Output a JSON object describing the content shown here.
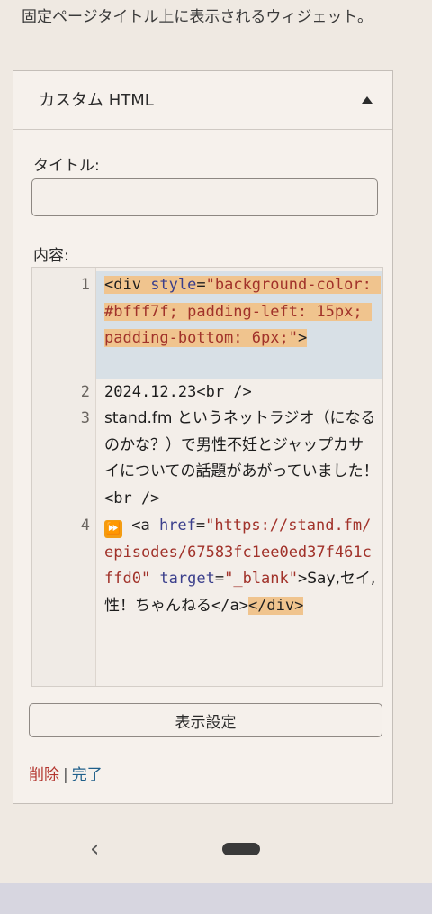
{
  "intro_text": "固定ページタイトル上に表示されるウィジェット。",
  "widget": {
    "title": "カスタム HTML",
    "title_label": "タイトル:",
    "title_value": "",
    "content_label": "内容:",
    "code": {
      "line_numbers": [
        "1",
        "2",
        "3",
        "4"
      ],
      "l1_open": "<div ",
      "l1_attr": "style",
      "l1_eq": "=",
      "l1_val": "\"background-color: #bfff7f; padding-left: 15px; padding-bottom: 6px;\"",
      "l1_close": ">",
      "l2_text": "2024.12.23",
      "l2_br": "<br />",
      "l3_text": "stand.fm というネットラジオ（になるのかな？）で男性不妊とジャップカサイについての話題があがっていました！",
      "l3_br": "<br />",
      "l4_icon": "⏩",
      "l4_open": " <a ",
      "l4_href_attr": "href",
      "l4_href_val": "\"https://stand.fm/episodes/67583fc1ee0ed37f461cffd0\"",
      "l4_target_attr": "target",
      "l4_target_val": "\"_blank\"",
      "l4_gt": ">",
      "l4_text": "Say,セイ,性！ちゃんねる",
      "l4_a_close": "</a>",
      "l4_div_close": "</div>"
    },
    "settings_button": "表示設定",
    "delete_link": "削除",
    "separator": "|",
    "done_link": "完了"
  },
  "nav": {
    "back_icon": "back-icon",
    "home_icon": "home-pill"
  }
}
